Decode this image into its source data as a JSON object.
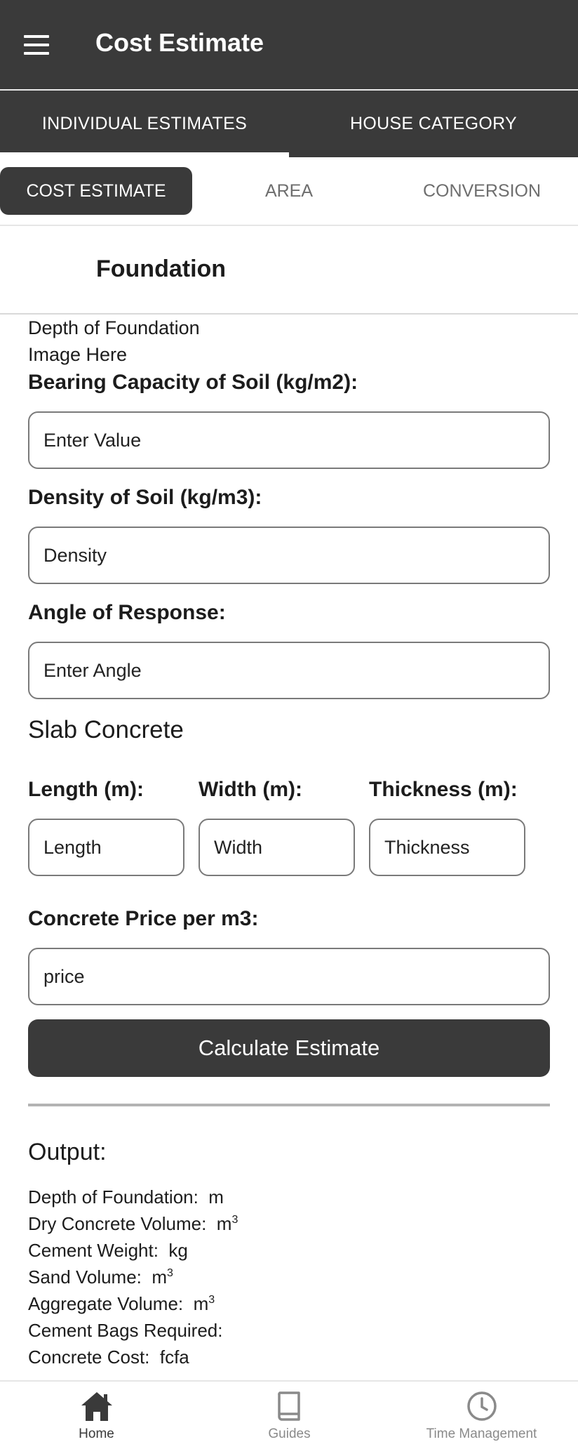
{
  "header": {
    "title": "Cost Estimate",
    "menu_icon": "hamburger-menu-icon"
  },
  "top_tabs": [
    "INDIVIDUAL ESTIMATES",
    "HOUSE CATEGORY"
  ],
  "sub_tabs": [
    "COST ESTIMATE",
    "AREA",
    "CONVERSION"
  ],
  "section": {
    "title": "Foundation"
  },
  "content": {
    "depth_text": "Depth of Foundation",
    "image_placeholder": "Image Here",
    "bearing_label": "Bearing Capacity of Soil (kg/m2):",
    "bearing_placeholder": "Enter Value",
    "density_label": "Density of Soil (kg/m3):",
    "density_placeholder": "Density",
    "angle_label": "Angle of Response:",
    "angle_placeholder": "Enter Angle",
    "slab_heading": "Slab Concrete",
    "length_label": "Length (m):",
    "length_placeholder": "Length",
    "width_label": "Width (m):",
    "width_placeholder": "Width",
    "thickness_label": "Thickness (m):",
    "thickness_placeholder": "Thickness",
    "price_label": "Concrete Price per m3:",
    "price_placeholder": "price",
    "calculate_label": "Calculate Estimate"
  },
  "output": {
    "heading": "Output:",
    "depth": "Depth of Foundation:  m",
    "dry_volume": "Dry Concrete Volume:  m",
    "cement_weight": "Cement Weight:  kg",
    "sand_volume": "Sand Volume:  m",
    "aggregate_volume": "Aggregate Volume:  m",
    "cement_bags": "Cement Bags Required:",
    "concrete_cost": "Concrete Cost:  fcfa",
    "cube_superscript": "3"
  },
  "bottom_nav": [
    {
      "label": "Home",
      "icon": "home-icon"
    },
    {
      "label": "Guides",
      "icon": "book-icon"
    },
    {
      "label": "Time Management",
      "icon": "clock-icon"
    }
  ],
  "colors": {
    "primary": "#3a3a3a",
    "background": "#ffffff",
    "inactive_text": "#6e6e6e"
  }
}
